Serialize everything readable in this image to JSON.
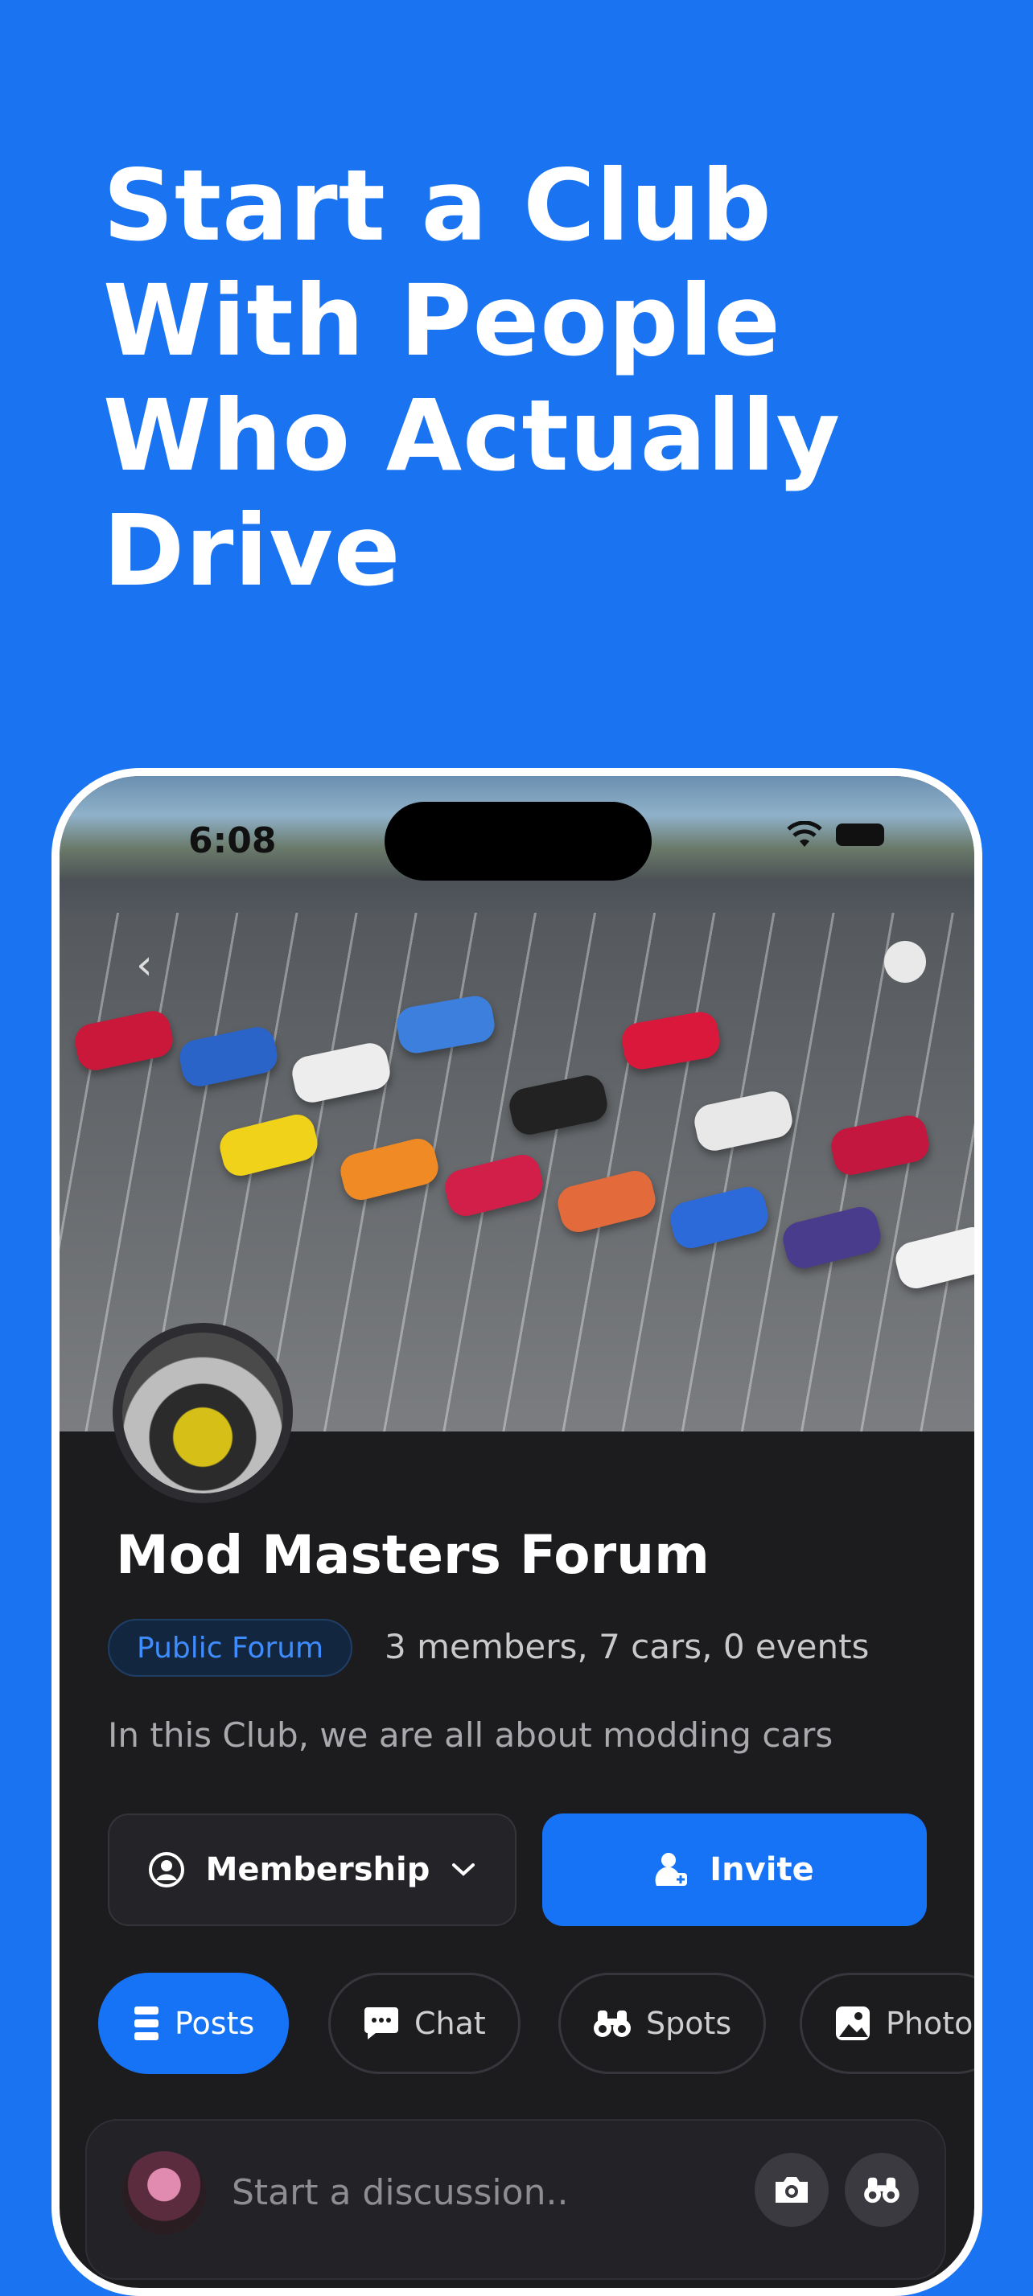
{
  "promo": {
    "headline_lines": [
      "Start a Club",
      "With People",
      "Who Actually",
      "Drive"
    ]
  },
  "status_bar": {
    "time": "6:08"
  },
  "club": {
    "name": "Mod Masters Forum",
    "visibility_badge": "Public Forum",
    "stats": "3 members, 7 cars, 0 events",
    "description": "In this Club, we are all about modding cars"
  },
  "actions": {
    "membership_label": "Membership",
    "invite_label": "Invite"
  },
  "tabs": [
    {
      "label": "Posts",
      "icon": "posts-icon",
      "active": true
    },
    {
      "label": "Chat",
      "icon": "chat-icon",
      "active": false
    },
    {
      "label": "Spots",
      "icon": "binoculars-icon",
      "active": false
    },
    {
      "label": "Photo",
      "icon": "photo-icon",
      "active": false
    }
  ],
  "composer": {
    "placeholder": "Start a discussion.."
  },
  "colors": {
    "background": "#1a73f0",
    "accent": "#1673f5",
    "panel": "#1c1c1f"
  }
}
